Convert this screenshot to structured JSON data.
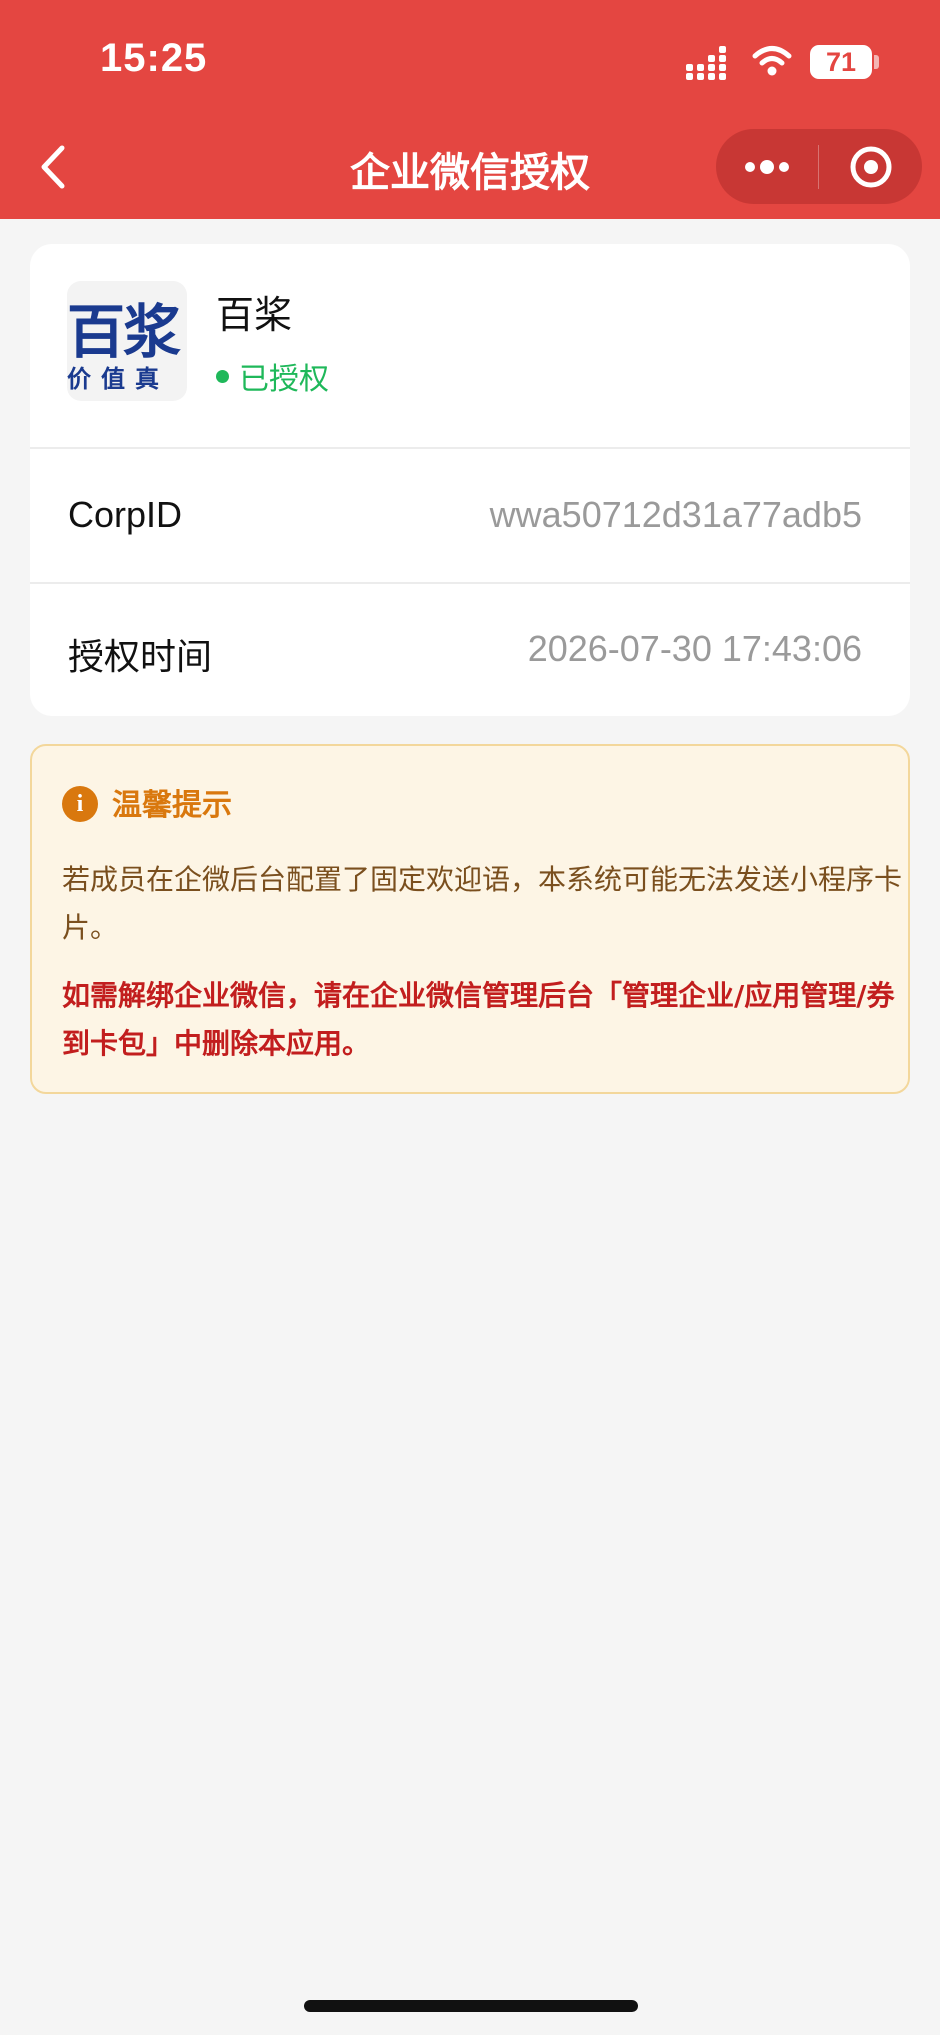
{
  "status_bar": {
    "time": "15:25",
    "battery": "71"
  },
  "nav": {
    "title": "企业微信授权"
  },
  "org": {
    "logo_text": "百浆",
    "logo_tagline": "价值真",
    "name": "百桨",
    "status": "已授权"
  },
  "info": [
    {
      "label": "CorpID",
      "value": "wwa50712d31a77adb5"
    },
    {
      "label": "授权时间",
      "value": "2026-07-30 17:43:06"
    }
  ],
  "tip": {
    "icon_glyph": "i",
    "title": "温馨提示",
    "text": "若成员在企微后台配置了固定欢迎语，本系统可能无法发送小程序卡片。",
    "warning": "如需解绑企业微信，请在企业微信管理后台「管理企业/应用管理/券到卡包」中删除本应用。"
  },
  "colors": {
    "header": "#e44641",
    "success": "#1fb85a",
    "tip_accent": "#d9780e",
    "warning": "#c21e1e"
  }
}
